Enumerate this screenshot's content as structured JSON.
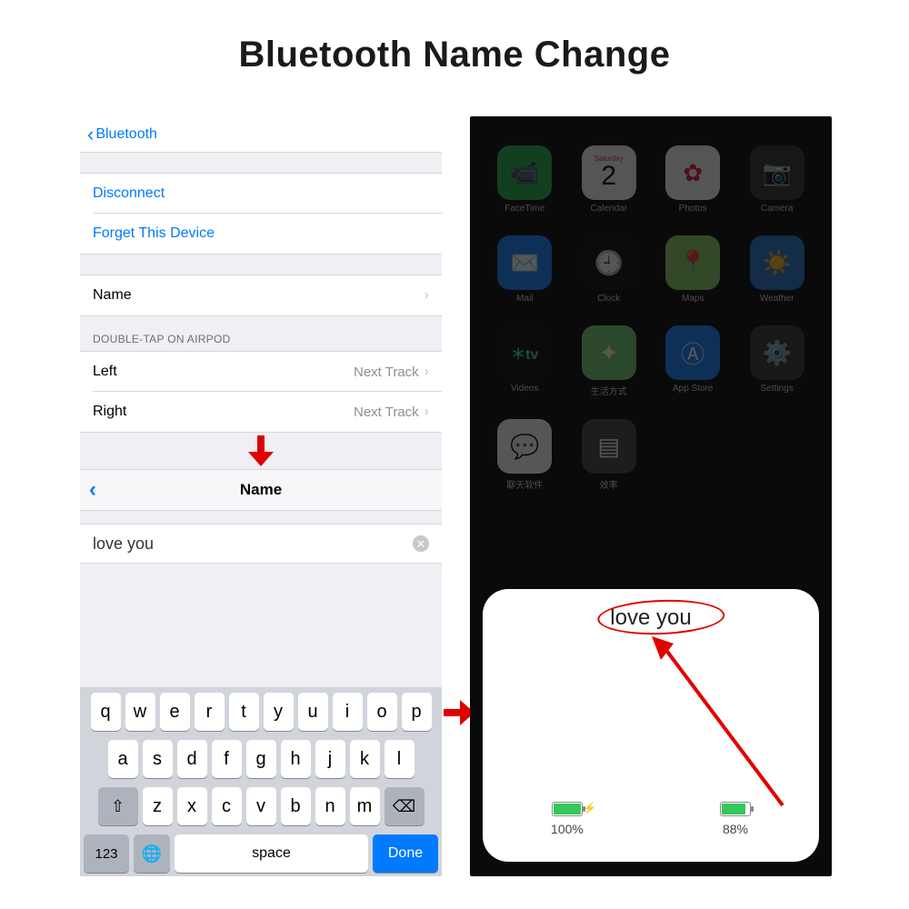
{
  "title": "Bluetooth Name Change",
  "left": {
    "back_label": "Bluetooth",
    "actions": {
      "disconnect": "Disconnect",
      "forget": "Forget This Device"
    },
    "name_row": {
      "label": "Name"
    },
    "section_header": "DOUBLE-TAP ON AIRPOD",
    "left_row": {
      "label": "Left",
      "value": "Next Track"
    },
    "right_row": {
      "label": "Right",
      "value": "Next Track"
    },
    "name_edit": {
      "title": "Name",
      "value": "love you"
    },
    "keyboard": {
      "row1": [
        "q",
        "w",
        "e",
        "r",
        "t",
        "y",
        "u",
        "i",
        "o",
        "p"
      ],
      "row2": [
        "a",
        "s",
        "d",
        "f",
        "g",
        "h",
        "j",
        "k",
        "l"
      ],
      "row3": [
        "z",
        "x",
        "c",
        "v",
        "b",
        "n",
        "m"
      ],
      "shift_glyph": "⇧",
      "backspace_glyph": "⌫",
      "num_label": "123",
      "globe_glyph": "🌐",
      "space_label": "space",
      "done_label": "Done"
    }
  },
  "right": {
    "apps": [
      {
        "label": "FaceTime",
        "bg": "#2fb85a",
        "glyph": "📹"
      },
      {
        "label": "Calendar",
        "bg": "#ffffff",
        "glyph": "2",
        "fg": "#111",
        "sub": "Saturday"
      },
      {
        "label": "Photos",
        "bg": "#ffffff",
        "glyph": "✿",
        "fg": "#e24"
      },
      {
        "label": "Camera",
        "bg": "#3a3a3c",
        "glyph": "📷"
      },
      {
        "label": "Mail",
        "bg": "#1e88ff",
        "glyph": "✉️"
      },
      {
        "label": "Clock",
        "bg": "#111111",
        "glyph": "🕘"
      },
      {
        "label": "Maps",
        "bg": "#8fd46a",
        "glyph": "📍"
      },
      {
        "label": "Weather",
        "bg": "#2a7bd1",
        "glyph": "☀️"
      },
      {
        "label": "Videos",
        "bg": "#111111",
        "glyph": "tv",
        "fg": "#3fe3a0"
      },
      {
        "label": "生活方式",
        "bg": "#7ad17a",
        "glyph": "✦"
      },
      {
        "label": "App Store",
        "bg": "#1e88ff",
        "glyph": "Ⓐ"
      },
      {
        "label": "Settings",
        "bg": "#3a3a3c",
        "glyph": "⚙️"
      },
      {
        "label": "聊天软件",
        "bg": "#ffffff",
        "glyph": "💬",
        "fg": "#1e88ff"
      },
      {
        "label": "效率",
        "bg": "#4a4a4c",
        "glyph": "▤"
      }
    ],
    "popup": {
      "title": "love you",
      "batt1": {
        "percent": "100%",
        "fill": 100,
        "charging": true
      },
      "batt2": {
        "percent": "88%",
        "fill": 88,
        "charging": false
      }
    }
  }
}
